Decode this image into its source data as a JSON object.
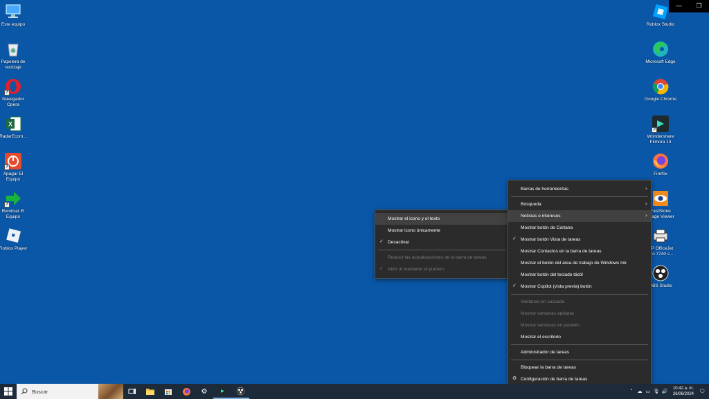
{
  "desktop_left": [
    {
      "label": "Este equipo",
      "icon": "computer-icon"
    },
    {
      "label": "Papelera de reciclaje",
      "icon": "recycle-bin-icon"
    },
    {
      "label": "Navegador Opera",
      "icon": "opera-icon"
    },
    {
      "label": "RadarEcom...",
      "icon": "excel-icon"
    },
    {
      "label": "Apagar El Equipo",
      "icon": "power-icon"
    },
    {
      "label": "Reiniciar El Equipo",
      "icon": "restart-arrow-icon"
    },
    {
      "label": "Roblox Player",
      "icon": "roblox-icon"
    }
  ],
  "desktop_right": [
    {
      "label": "Roblox Studio",
      "icon": "roblox-studio-icon"
    },
    {
      "label": "Microsoft Edge",
      "icon": "edge-icon"
    },
    {
      "label": "Google Chrome",
      "icon": "chrome-icon"
    },
    {
      "label": "Wondershare Filmora 13",
      "icon": "filmora-icon"
    },
    {
      "label": "Firefox",
      "icon": "firefox-icon"
    },
    {
      "label": "FastStone Image Viewer",
      "icon": "faststone-icon"
    },
    {
      "label": "HP OfficeJet Pro 7740 s...",
      "icon": "printer-icon"
    },
    {
      "label": "OBS Studio",
      "icon": "obs-icon"
    }
  ],
  "taskbar_menu": {
    "items": [
      {
        "label": "Barras de herramientas",
        "submenu": true
      },
      {
        "label": "Búsqueda",
        "submenu": true
      },
      {
        "label": "Noticias e intereses",
        "submenu": true,
        "highlight": true
      },
      {
        "label": "Mostrar botón de Cortana"
      },
      {
        "label": "Mostrar botón Vista de tareas",
        "checked": true
      },
      {
        "label": "Mostrar Contactos en la barra de tareas"
      },
      {
        "label": "Mostrar el botón del área de trabajo de Windows Ink"
      },
      {
        "label": "Mostrar botón del teclado táctil"
      },
      {
        "label": "Mostrar Copilot (vista previa) botón",
        "checked": true
      },
      {
        "sep": true
      },
      {
        "label": "Ventanas en cascada",
        "disabled": true
      },
      {
        "label": "Mostrar ventanas apiladas",
        "disabled": true
      },
      {
        "label": "Mostrar ventanas en paralelo",
        "disabled": true
      },
      {
        "label": "Mostrar el escritorio"
      },
      {
        "sep": true
      },
      {
        "label": "Administrador de tareas"
      },
      {
        "sep": true
      },
      {
        "label": "Bloquear la barra de tareas"
      },
      {
        "label": "Configuración de barra de tareas",
        "gear": true
      }
    ]
  },
  "news_submenu": {
    "items": [
      {
        "label": "Mostrar el icono y el texto",
        "highlight": true
      },
      {
        "label": "Mostrar icono únicamente"
      },
      {
        "label": "Desactivar",
        "checked": true
      },
      {
        "sep": true
      },
      {
        "label": "Reducir las actualizaciones de la barra de tareas",
        "disabled": true
      },
      {
        "label": "Abrir al mantener el puntero",
        "disabled": true,
        "checked": true
      }
    ]
  },
  "taskbar": {
    "search_placeholder": "Buscar",
    "apps": [
      "task-view-icon",
      "file-explorer-icon",
      "store-icon",
      "firefox-icon",
      "settings-icon",
      "filmora-icon",
      "obs-icon"
    ],
    "time": "10:42 a. m.",
    "date": "26/06/2024"
  },
  "colors": {
    "desktop": "#0a57a8",
    "menu_bg": "#2b2b2b",
    "taskbar": "#1c2a3a"
  }
}
